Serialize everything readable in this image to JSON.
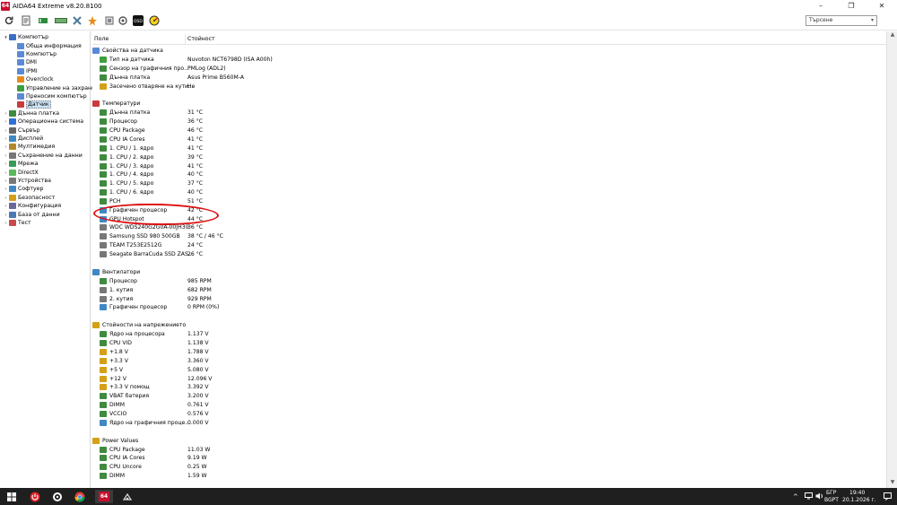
{
  "window": {
    "title": "AIDA64 Extreme v8.20.8100",
    "app_icon_text": "64",
    "minimize": "–",
    "restore": "❐",
    "close": "✕"
  },
  "search": {
    "placeholder": "Търсене"
  },
  "list_header": {
    "field": "Поле",
    "value": "Стойност"
  },
  "tree": [
    {
      "label": "Компютър",
      "level": 0,
      "expander": "▾",
      "icon_color": "#3a6fc4"
    },
    {
      "label": "Обща информация",
      "level": 2,
      "expander": "",
      "icon_color": "#5a8ad6"
    },
    {
      "label": "Компютър",
      "level": 2,
      "expander": "",
      "icon_color": "#5a8ad6"
    },
    {
      "label": "DMI",
      "level": 2,
      "expander": "",
      "icon_color": "#5a8ad6"
    },
    {
      "label": "IPMI",
      "level": 2,
      "expander": "",
      "icon_color": "#5a8ad6"
    },
    {
      "label": "Overclock",
      "level": 2,
      "expander": "",
      "icon_color": "#e58b1c"
    },
    {
      "label": "Управление на захранв",
      "level": 2,
      "expander": "",
      "icon_color": "#3f9f3f"
    },
    {
      "label": "Преносим компютър",
      "level": 2,
      "expander": "",
      "icon_color": "#5a8ad6"
    },
    {
      "label": "Датчик",
      "level": 2,
      "expander": "",
      "icon_color": "#c93c3c",
      "selected": true
    },
    {
      "label": "Дънна платка",
      "level": 0,
      "expander": "›",
      "icon_color": "#3f8a3f"
    },
    {
      "label": "Операционна система",
      "level": 0,
      "expander": "›",
      "icon_color": "#2f73d4"
    },
    {
      "label": "Сървър",
      "level": 0,
      "expander": "›",
      "icon_color": "#666666"
    },
    {
      "label": "Дисплей",
      "level": 0,
      "expander": "›",
      "icon_color": "#3f88c4"
    },
    {
      "label": "Мултимедия",
      "level": 0,
      "expander": "›",
      "icon_color": "#b5892a"
    },
    {
      "label": "Съхранение на данни",
      "level": 0,
      "expander": "›",
      "icon_color": "#777777"
    },
    {
      "label": "Мрежа",
      "level": 0,
      "expander": "›",
      "icon_color": "#3a9a5a"
    },
    {
      "label": "DirectX",
      "level": 0,
      "expander": "›",
      "icon_color": "#5cb85c"
    },
    {
      "label": "Устройства",
      "level": 0,
      "expander": "›",
      "icon_color": "#777777"
    },
    {
      "label": "Софтуер",
      "level": 0,
      "expander": "›",
      "icon_color": "#3f88c4"
    },
    {
      "label": "Безопасност",
      "level": 0,
      "expander": "›",
      "icon_color": "#d4a017"
    },
    {
      "label": "Конфигурация",
      "level": 0,
      "expander": "›",
      "icon_color": "#6a6a9a"
    },
    {
      "label": "База от данни",
      "level": 0,
      "expander": "›",
      "icon_color": "#4a7ab5"
    },
    {
      "label": "Тест",
      "level": 0,
      "expander": "›",
      "icon_color": "#c84b4b"
    }
  ],
  "rows": [
    {
      "type": "group",
      "field": "Свойства на датчика",
      "value": "",
      "icon_color": "#5a8ad6"
    },
    {
      "type": "item",
      "field": "Тип на датчика",
      "value": "Nuvoton NCT6798D  (ISA A00h)",
      "icon_color": "#3f9f3f"
    },
    {
      "type": "item",
      "field": "Сензор на графичния про...",
      "value": "PMLog  (ADL2)",
      "icon_color": "#3f8a3f"
    },
    {
      "type": "item",
      "field": "Дънна платка",
      "value": "Asus Prime B560M-A",
      "icon_color": "#3f8a3f"
    },
    {
      "type": "item",
      "field": "Засечено отваряне на кути...",
      "value": "Не",
      "icon_color": "#d4a017"
    },
    {
      "type": "group",
      "field": "Температури",
      "value": "",
      "icon_color": "#c93c3c"
    },
    {
      "type": "item",
      "field": "Дънна платка",
      "value": "31 °C",
      "icon_color": "#3f8a3f"
    },
    {
      "type": "item",
      "field": "Процесор",
      "value": "36 °C",
      "icon_color": "#3f8a3f"
    },
    {
      "type": "item",
      "field": "CPU Package",
      "value": "46 °C",
      "icon_color": "#3f8a3f"
    },
    {
      "type": "item",
      "field": "CPU IA Cores",
      "value": "41 °C",
      "icon_color": "#3f8a3f"
    },
    {
      "type": "item",
      "field": "1. CPU / 1. ядро",
      "value": "41 °C",
      "icon_color": "#3f8a3f"
    },
    {
      "type": "item",
      "field": "1. CPU / 2. ядро",
      "value": "39 °C",
      "icon_color": "#3f8a3f"
    },
    {
      "type": "item",
      "field": "1. CPU / 3. ядро",
      "value": "41 °C",
      "icon_color": "#3f8a3f"
    },
    {
      "type": "item",
      "field": "1. CPU / 4. ядро",
      "value": "40 °C",
      "icon_color": "#3f8a3f"
    },
    {
      "type": "item",
      "field": "1. CPU / 5. ядро",
      "value": "37 °C",
      "icon_color": "#3f8a3f"
    },
    {
      "type": "item",
      "field": "1. CPU / 6. ядро",
      "value": "40 °C",
      "icon_color": "#3f8a3f"
    },
    {
      "type": "item",
      "field": "PCH",
      "value": "51 °C",
      "icon_color": "#3f8a3f"
    },
    {
      "type": "item",
      "field": "Графичен процесор",
      "value": "42 °C",
      "icon_color": "#3f88c4"
    },
    {
      "type": "item",
      "field": "GPU Hotspot",
      "value": "44 °C",
      "icon_color": "#3f88c4"
    },
    {
      "type": "item",
      "field": "WDC WDS240G2G0A-00JH30",
      "value": "36 °C",
      "icon_color": "#777777"
    },
    {
      "type": "item",
      "field": "Samsung SSD 980 500GB",
      "value": "38 °C / 46 °C",
      "icon_color": "#777777"
    },
    {
      "type": "item",
      "field": "TEAM T253E2512G",
      "value": "24 °C",
      "icon_color": "#777777"
    },
    {
      "type": "item",
      "field": "Seagate BarraCuda SSD ZAS...",
      "value": "26 °C",
      "icon_color": "#777777"
    },
    {
      "type": "group",
      "field": "Вентилатори",
      "value": "",
      "icon_color": "#3f88c4"
    },
    {
      "type": "item",
      "field": "Процесор",
      "value": "985 RPM",
      "icon_color": "#3f8a3f"
    },
    {
      "type": "item",
      "field": "1. кутия",
      "value": "682 RPM",
      "icon_color": "#777777"
    },
    {
      "type": "item",
      "field": "2. кутия",
      "value": "929 RPM",
      "icon_color": "#777777"
    },
    {
      "type": "item",
      "field": "Графичен процесор",
      "value": "0 RPM  (0%)",
      "icon_color": "#3f88c4"
    },
    {
      "type": "group",
      "field": "Стойности на напрежението",
      "value": "",
      "icon_color": "#d4a017"
    },
    {
      "type": "item",
      "field": "Ядро на процесора",
      "value": "1.137 V",
      "icon_color": "#3f8a3f"
    },
    {
      "type": "item",
      "field": "CPU VID",
      "value": "1.138 V",
      "icon_color": "#3f8a3f"
    },
    {
      "type": "item",
      "field": "+1.8 V",
      "value": "1.788 V",
      "icon_color": "#d4a017"
    },
    {
      "type": "item",
      "field": "+3.3 V",
      "value": "3.360 V",
      "icon_color": "#d4a017"
    },
    {
      "type": "item",
      "field": "+5 V",
      "value": "5.080 V",
      "icon_color": "#d4a017"
    },
    {
      "type": "item",
      "field": "+12 V",
      "value": "12.096 V",
      "icon_color": "#d4a017"
    },
    {
      "type": "item",
      "field": "+3.3 V помощ",
      "value": "3.392 V",
      "icon_color": "#d4a017"
    },
    {
      "type": "item",
      "field": "VBAT батерия",
      "value": "3.200 V",
      "icon_color": "#3f8a3f"
    },
    {
      "type": "item",
      "field": "DIMM",
      "value": "0.761 V",
      "icon_color": "#3f8a3f"
    },
    {
      "type": "item",
      "field": "VCCIO",
      "value": "0.576 V",
      "icon_color": "#3f8a3f"
    },
    {
      "type": "item",
      "field": "Ядро на графичния проце...",
      "value": "0.000 V",
      "icon_color": "#3f88c4"
    },
    {
      "type": "group",
      "field": "Power Values",
      "value": "",
      "icon_color": "#d4a017"
    },
    {
      "type": "item",
      "field": "CPU Package",
      "value": "11.03 W",
      "icon_color": "#3f8a3f"
    },
    {
      "type": "item",
      "field": "CPU IA Cores",
      "value": "9.19 W",
      "icon_color": "#3f8a3f"
    },
    {
      "type": "item",
      "field": "CPU Uncore",
      "value": "0.25 W",
      "icon_color": "#3f8a3f"
    },
    {
      "type": "item",
      "field": "DIMM",
      "value": "1.59 W",
      "icon_color": "#3f8a3f"
    }
  ],
  "tray": {
    "lang1": "БГР",
    "lang2": "BGPT",
    "time": "19:40",
    "date": "20.1.2026 г."
  },
  "taskbar_app_text": "64"
}
